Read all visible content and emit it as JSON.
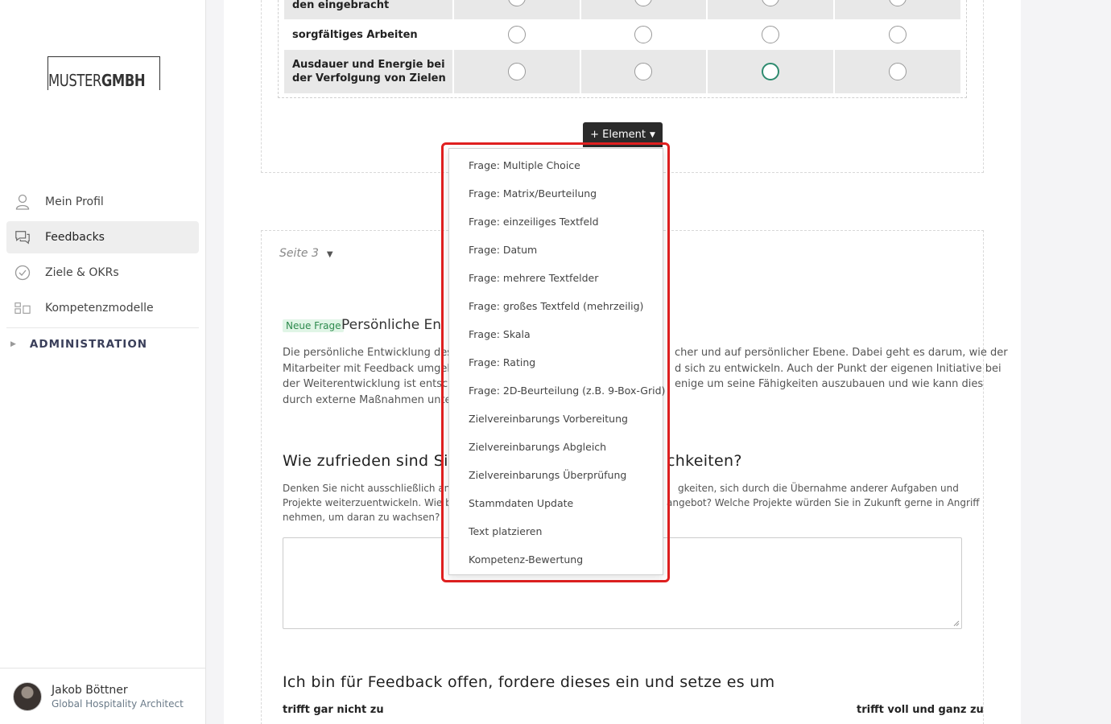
{
  "brand": {
    "logo_prefix": "MUSTER",
    "logo_suffix": "GMBH"
  },
  "sidebar": {
    "items": [
      {
        "label": "Mein Profil",
        "icon": "user-icon"
      },
      {
        "label": "Feedbacks",
        "icon": "chat-icon",
        "active": true
      },
      {
        "label": "Ziele & OKRs",
        "icon": "check-circle-icon"
      },
      {
        "label": "Kompetenzmodelle",
        "icon": "model-icon"
      }
    ],
    "admin_label": "ADMINISTRATION"
  },
  "user": {
    "name": "Jakob Böttner",
    "role": "Global Hospitality Architect"
  },
  "matrix": {
    "rows": [
      {
        "label": "den eingebracht",
        "selected": -1
      },
      {
        "label": "sorgfältiges Arbeiten",
        "selected": -1
      },
      {
        "label": "Ausdauer und Energie bei der Verfolgung von Zielen",
        "selected": 2
      }
    ]
  },
  "element_button": {
    "label": "+ Element"
  },
  "dropdown": {
    "items": [
      "Frage: Multiple Choice",
      "Frage: Matrix/Beurteilung",
      "Frage: einzeiliges Textfeld",
      "Frage: Datum",
      "Frage: mehrere Textfelder",
      "Frage: großes Textfeld (mehrzeilig)",
      "Frage: Skala",
      "Frage: Rating",
      "Frage: 2D-Beurteilung (z.B. 9-Box-Grid)",
      "Zielvereinbarungs Vorbereitung",
      "Zielvereinbarungs Abgleich",
      "Zielvereinbarungs Überprüfung",
      "Stammdaten Update",
      "Text platzieren",
      "Kompetenz-Bewertung"
    ]
  },
  "page3": {
    "label": "Seite 3",
    "badge": "Neue Frage",
    "title_start": "Persönliche Entw",
    "title_end": "",
    "intro_lines": [
      {
        "left": "Die persönliche Entwicklung des Mi",
        "right": "cher und auf persönlicher Ebene. Dabei geht es darum, wie der"
      },
      {
        "left": "Mitarbeiter mit Feedback umgeht u",
        "right": "d sich zu entwickeln. Auch der Punkt der eigenen Initiative bei"
      },
      {
        "left": "der Weiterentwicklung ist entschei",
        "right": "enige um seine Fähigkeiten auszubauen und wie kann dies"
      },
      {
        "left": "durch externe Maßnahmen unters",
        "right": ""
      }
    ],
    "q2_start": "Wie zufrieden sind Sie",
    "q2_end": "chkeiten?",
    "q2_lines": [
      {
        "left": "Denken Sie nicht ausschließlich an Tr",
        "right": "gkeiten, sich durch die Übernahme anderer Aufgaben und"
      },
      {
        "left": "Projekte weiterzuentwickeln. Wie bew",
        "right": "angebot? Welche Projekte würden Sie in Zukunft gerne in Angriff"
      },
      {
        "left": "nehmen, um daran zu wachsen?",
        "right": ""
      }
    ],
    "q3": "Ich bin für Feedback offen, fordere dieses ein und setze es um",
    "scale_low": "trifft gar nicht zu",
    "scale_high": "trifft voll und ganz zu"
  }
}
